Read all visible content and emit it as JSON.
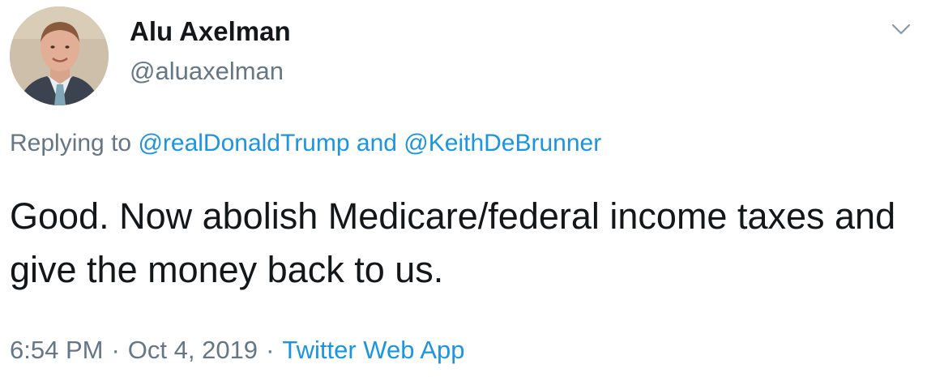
{
  "author": {
    "display_name": "Alu Axelman",
    "handle": "@aluaxelman"
  },
  "reply": {
    "prefix": "Replying to",
    "mention_1": "@realDonaldTrump",
    "joiner": "and",
    "mention_2": "@KeithDeBrunner"
  },
  "tweet": {
    "text": "Good. Now abolish Medicare/federal income taxes and give the money back to us."
  },
  "meta": {
    "time": "6:54 PM",
    "separator": "·",
    "date": "Oct 4, 2019",
    "source": "Twitter Web App"
  },
  "icons": {
    "menu": "chevron-down-icon"
  },
  "colors": {
    "text_primary": "#14171a",
    "text_secondary": "#657786",
    "link": "#1b95e0"
  }
}
